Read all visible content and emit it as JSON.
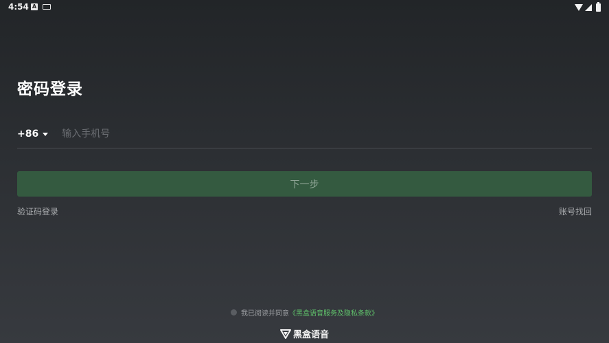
{
  "status_bar": {
    "time": "4:54",
    "icon_a_label": "A"
  },
  "login": {
    "title": "密码登录",
    "country_code": "+86",
    "phone_placeholder": "输入手机号",
    "next_button": "下一步",
    "code_login_link": "验证码登录",
    "account_recovery_link": "账号找回"
  },
  "agreement": {
    "prefix": "我已阅读并同意",
    "link": "《黑盒语音服务及隐私条款》"
  },
  "brand": {
    "name": "黑盒语音"
  },
  "colors": {
    "accent_button": "#345a40",
    "link_green": "#5fbf6a"
  }
}
